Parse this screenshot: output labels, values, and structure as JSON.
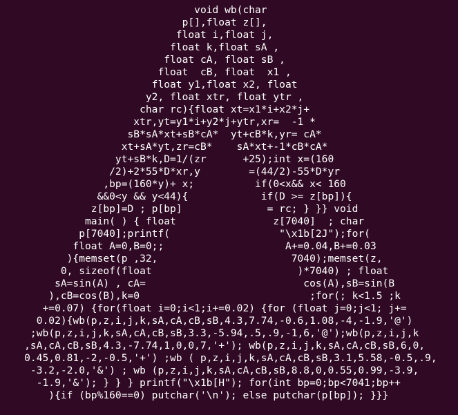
{
  "terminal": {
    "background": "#300a24",
    "foreground": "#ffffff",
    "lines": [
      "                                void wb(char",
      "                              p[],float z[],",
      "                             float i,float j,",
      "                            float k,float sA ,",
      "                           float cA, float sB ,",
      "                          float  cB, float  x1 ,",
      "                         float y1,float x2, float",
      "                        y2, float xtr, float ytr ,",
      "                       char rc){float xt=x1*i+x2*j+",
      "                      xtr,yt=y1*i+y2*j+ytr,xr=  -1 *",
      "                     sB*sA*xt+sB*cA*  yt+cB*k,yr= cA*",
      "                    xt+sA*yt,zr=cB*    sA*xt+-1*cB*cA*",
      "                   yt+sB*k,D=1/(zr      +25);int x=(160",
      "                  /2)+2*55*D*xr,y        =(44/2)-55*D*yr",
      "                 ,bp=(160*y)+ x;          if(0<x&& x< 160",
      "                &&0<y && y<44){            if(D >= z[bp]){",
      "               z[bp]=D ; p[bp]              = rc; } }} void",
      "              main( ) { float                z[7040]  ; char",
      "             p[7040];printf(                  \"\\x1b[2J\");for(",
      "            float A=0,B=0;;                    A+=0.04,B+=0.03",
      "           ){memset(p ,32,                      7040);memset(z,",
      "          0, sizeof(float                        )*7040) ; float",
      "         sA=sin(A) , cA=                          cos(A),sB=sin(B",
      "        ),cB=cos(B),k=0                            ;for(; k<1.5 ;k",
      "       +=0.07) {for(float i=0;i<1;i+=0.02) {for (float j=0;j<1; j+=",
      "      0.02){wb(p,z,i,j,k,sA,cA,cB,sB,4.3,7.74,-0.6,1.08,-4,-1.9,'@')",
      "     ;wb(p,z,i,j,k,sA,cA,cB,sB,3.3,-5.94,.5,.9,-1,6,'@');wb(p,z,i,j,k",
      "    ,sA,cA,cB,sB,4.3,-7.74,1,0,0,7,'+'); wb(p,z,i,j,k,sA,cA,cB,sB,6,0,",
      "    0.45,0.81,-2,-0.5,'+') ;wb ( p,z,i,j,k,sA,cA,cB,sB,3.1,5.58,-0.5,.9,",
      "     -3.2,-2.0,'&') ; wb (p,z,i,j,k,sA,cA,cB,sB,8.8,0,0.55,0.99,-3.9,",
      "      -1.9,'&'); } } } printf(\"\\x1b[H\"); for(int bp=0;bp<7041;bp++",
      "        ){if (bp%160==0) putchar('\\n'); else putchar(p[bp]); }}}"
    ]
  }
}
